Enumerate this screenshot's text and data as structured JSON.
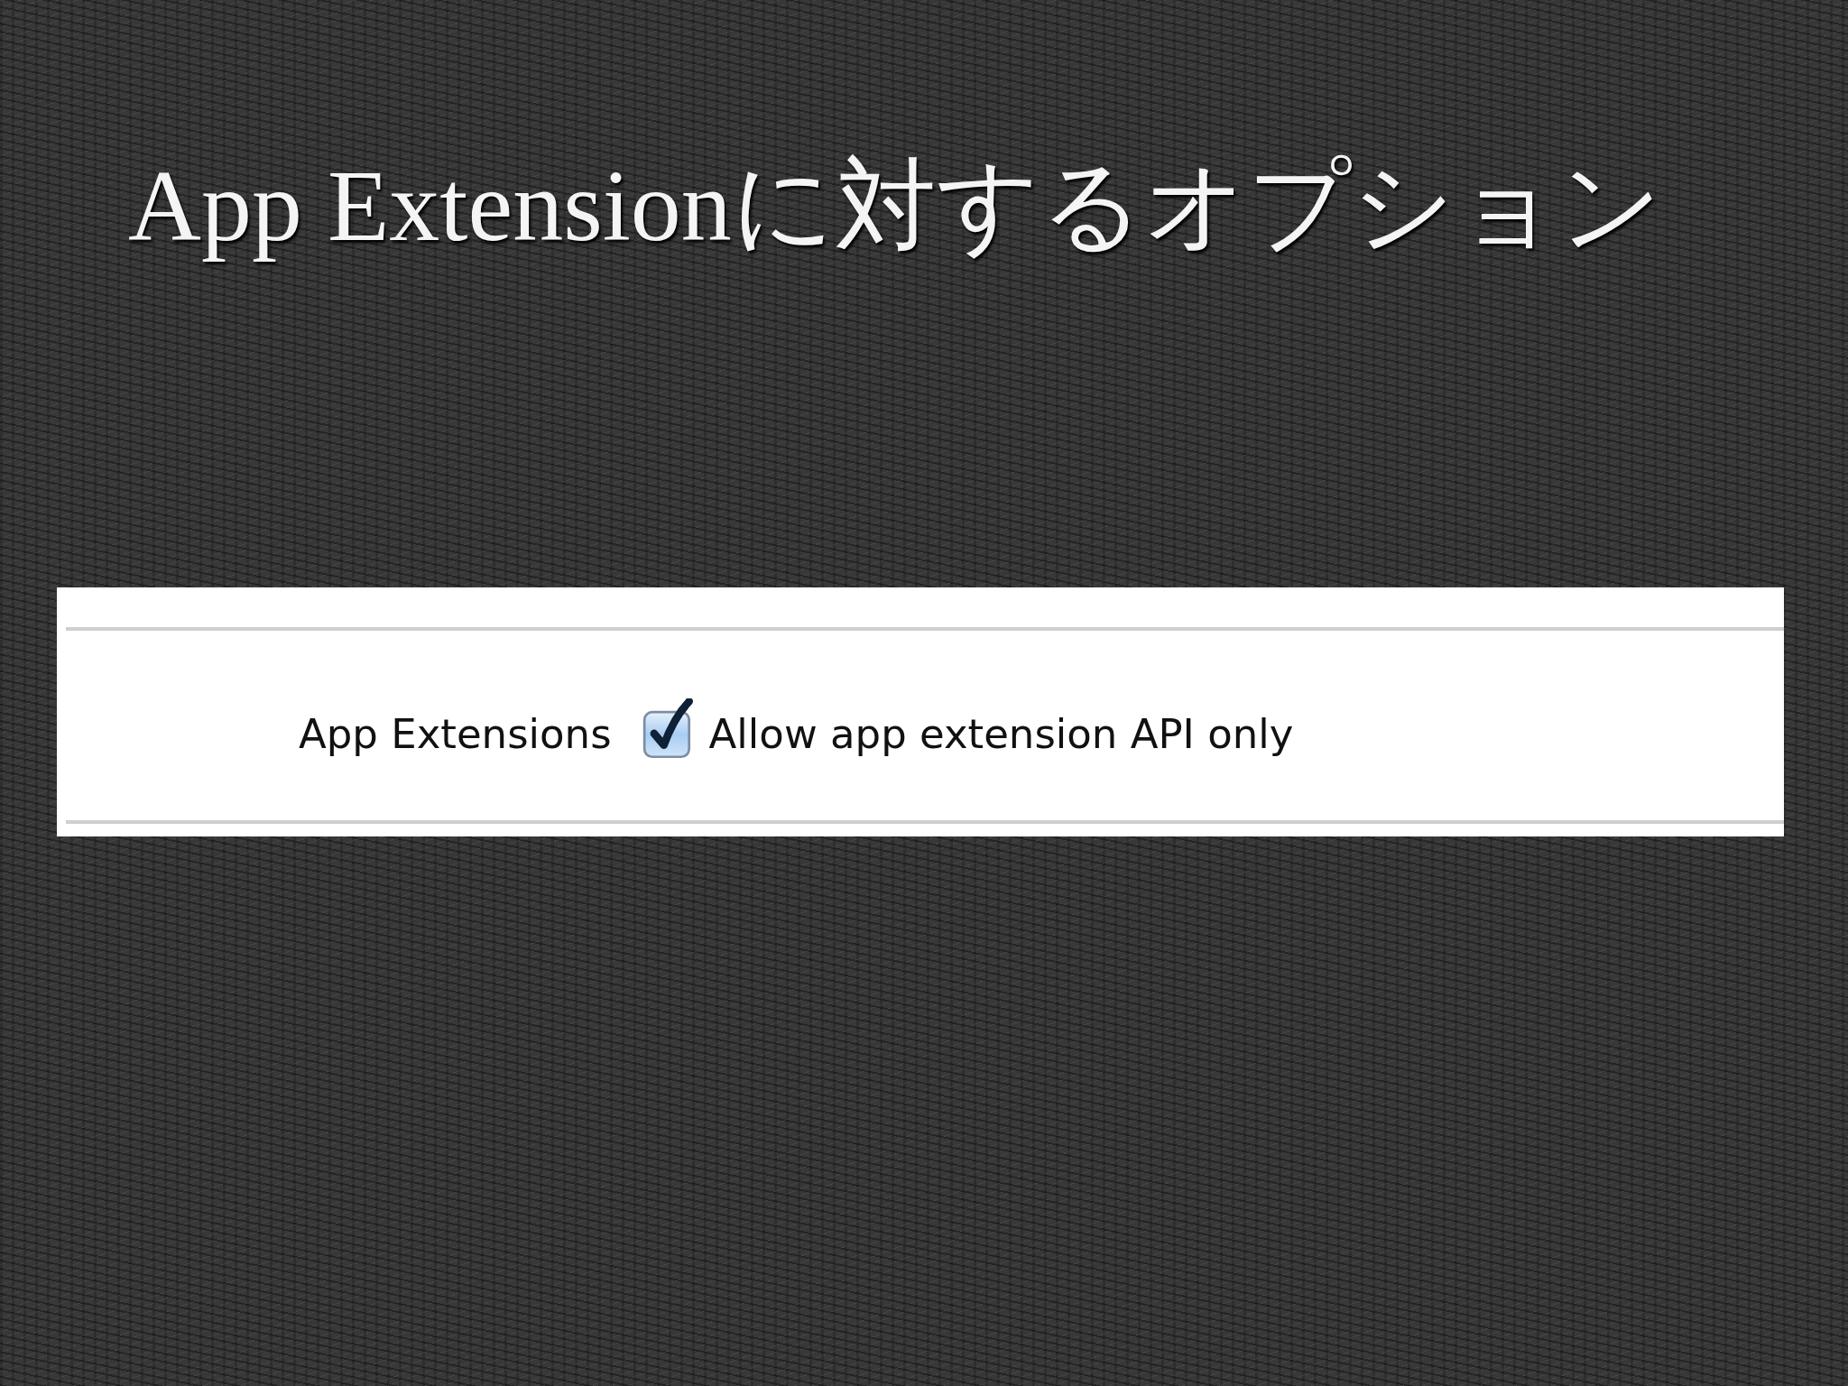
{
  "slide": {
    "title": "App Extensionに対するオプション"
  },
  "settings_panel": {
    "label": "App Extensions",
    "checkbox": {
      "label": "Allow app extension API only",
      "checked": true
    }
  }
}
